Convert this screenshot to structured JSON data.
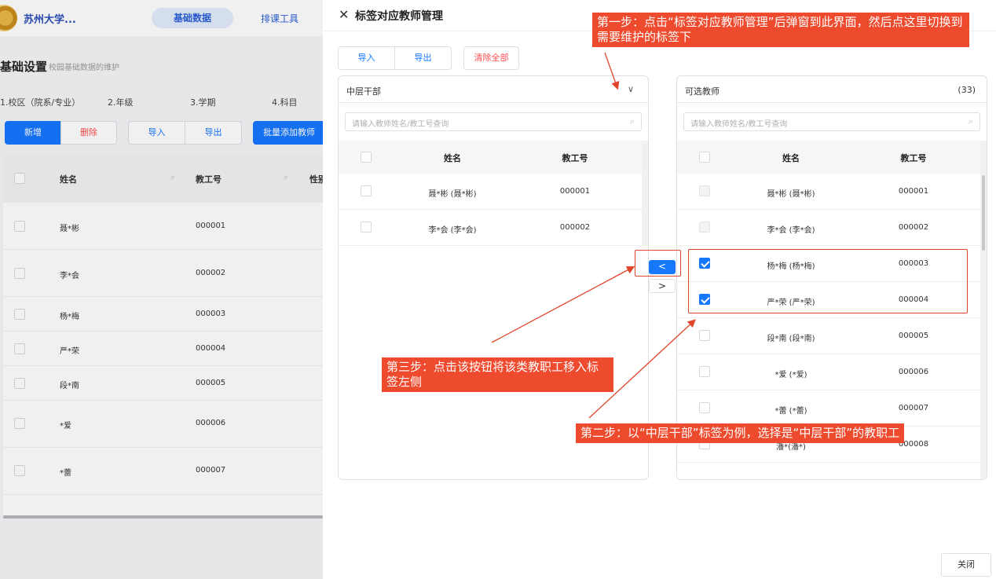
{
  "background": {
    "school_name": "苏州大学...",
    "nav": [
      "基础数据",
      "排课工具"
    ],
    "page_title": "基础设置",
    "page_subtitle": "校园基础数据的维护",
    "steps": [
      "1.校区（院系/专业）",
      "2.年级",
      "3.学期",
      "4.科目"
    ],
    "buttons": {
      "add": "新增",
      "delete": "删除",
      "import": "导入",
      "export": "导出",
      "batch_add": "批量添加教师"
    },
    "columns": [
      "姓名",
      "教工号",
      "性别"
    ],
    "rows": [
      {
        "name": "聂*彬",
        "id": "000001"
      },
      {
        "name": "李*会",
        "id": "000002"
      },
      {
        "name": "杨*梅",
        "id": "000003"
      },
      {
        "name": "严*荣",
        "id": "000004"
      },
      {
        "name": "段*南",
        "id": "000005"
      },
      {
        "name": "*爱",
        "id": "000006"
      },
      {
        "name": "*蕾",
        "id": "000007"
      }
    ]
  },
  "drawer": {
    "title": "标签对应教师管理",
    "toolbar": {
      "import": "导入",
      "export": "导出",
      "clear_all": "清除全部"
    },
    "left_panel": {
      "tag_select": "中层干部",
      "search_placeholder": "请输入教师姓名/教工号查询",
      "columns": [
        "姓名",
        "教工号"
      ],
      "rows": [
        {
          "name": "聂*彬 (聂*彬)",
          "id": "000001"
        },
        {
          "name": "李*会 (李*会)",
          "id": "000002"
        }
      ]
    },
    "right_panel": {
      "title": "可选教师",
      "count": "(33)",
      "search_placeholder": "请输入教师姓名/教工号查询",
      "columns": [
        "姓名",
        "教工号"
      ],
      "rows": [
        {
          "name": "聂*彬 (聂*彬)",
          "id": "000001",
          "state": "disabled"
        },
        {
          "name": "李*会 (李*会)",
          "id": "000002",
          "state": "disabled"
        },
        {
          "name": "杨*梅 (杨*梅)",
          "id": "000003",
          "state": "checked"
        },
        {
          "name": "严*荣 (严*荣)",
          "id": "000004",
          "state": "checked"
        },
        {
          "name": "段*南 (段*南)",
          "id": "000005",
          "state": "unchecked"
        },
        {
          "name": "*爱 (*爱)",
          "id": "000006",
          "state": "unchecked"
        },
        {
          "name": "*蕾 (*蕾)",
          "id": "000007",
          "state": "unchecked"
        },
        {
          "name": "潘*(潘*)",
          "id": "000008",
          "state": "unchecked"
        }
      ]
    },
    "transfer": {
      "left": "<",
      "right": ">"
    },
    "close_button": "关闭"
  },
  "annotations": {
    "step1": "第一步：点击“标签对应教师管理”后弹窗到此界面，然后点这里切换到需要维护的标签下",
    "step2": "第二步：以“中层干部”标签为例，选择是“中层干部”的教职工",
    "step3": "第三步：点击该按钮将该类教职工移入标签左侧"
  },
  "colors": {
    "primary": "#1677ff",
    "danger": "#ff4d4f",
    "callout": "#ee4a2e"
  }
}
